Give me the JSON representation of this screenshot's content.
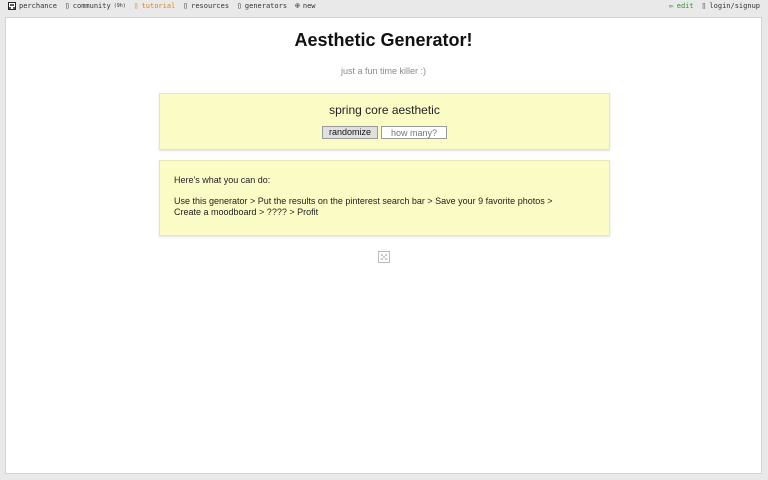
{
  "nav": {
    "brand": "perchance",
    "community": "community",
    "community_badge": "(9h)",
    "tutorial": "tutorial",
    "resources": "resources",
    "generators": "generators",
    "new": "new",
    "edit": "edit",
    "login": "login/signup"
  },
  "colors": {
    "accent_tutorial": "#d9822b",
    "accent_edit": "#2a9a2a",
    "box_background": "#fbfbc6"
  },
  "page": {
    "title": "Aesthetic Generator!",
    "subtitle": "just a fun time killer :)"
  },
  "generator": {
    "output": "spring core aesthetic",
    "randomize_label": "randomize",
    "count_placeholder": "how many?"
  },
  "info": {
    "heading": "Here's what you can do:",
    "line1": "Use this generator > Put the results on the pinterest search bar > Save your 9 favorite photos >",
    "line2": "Create a moodboard > ???? > Profit"
  }
}
